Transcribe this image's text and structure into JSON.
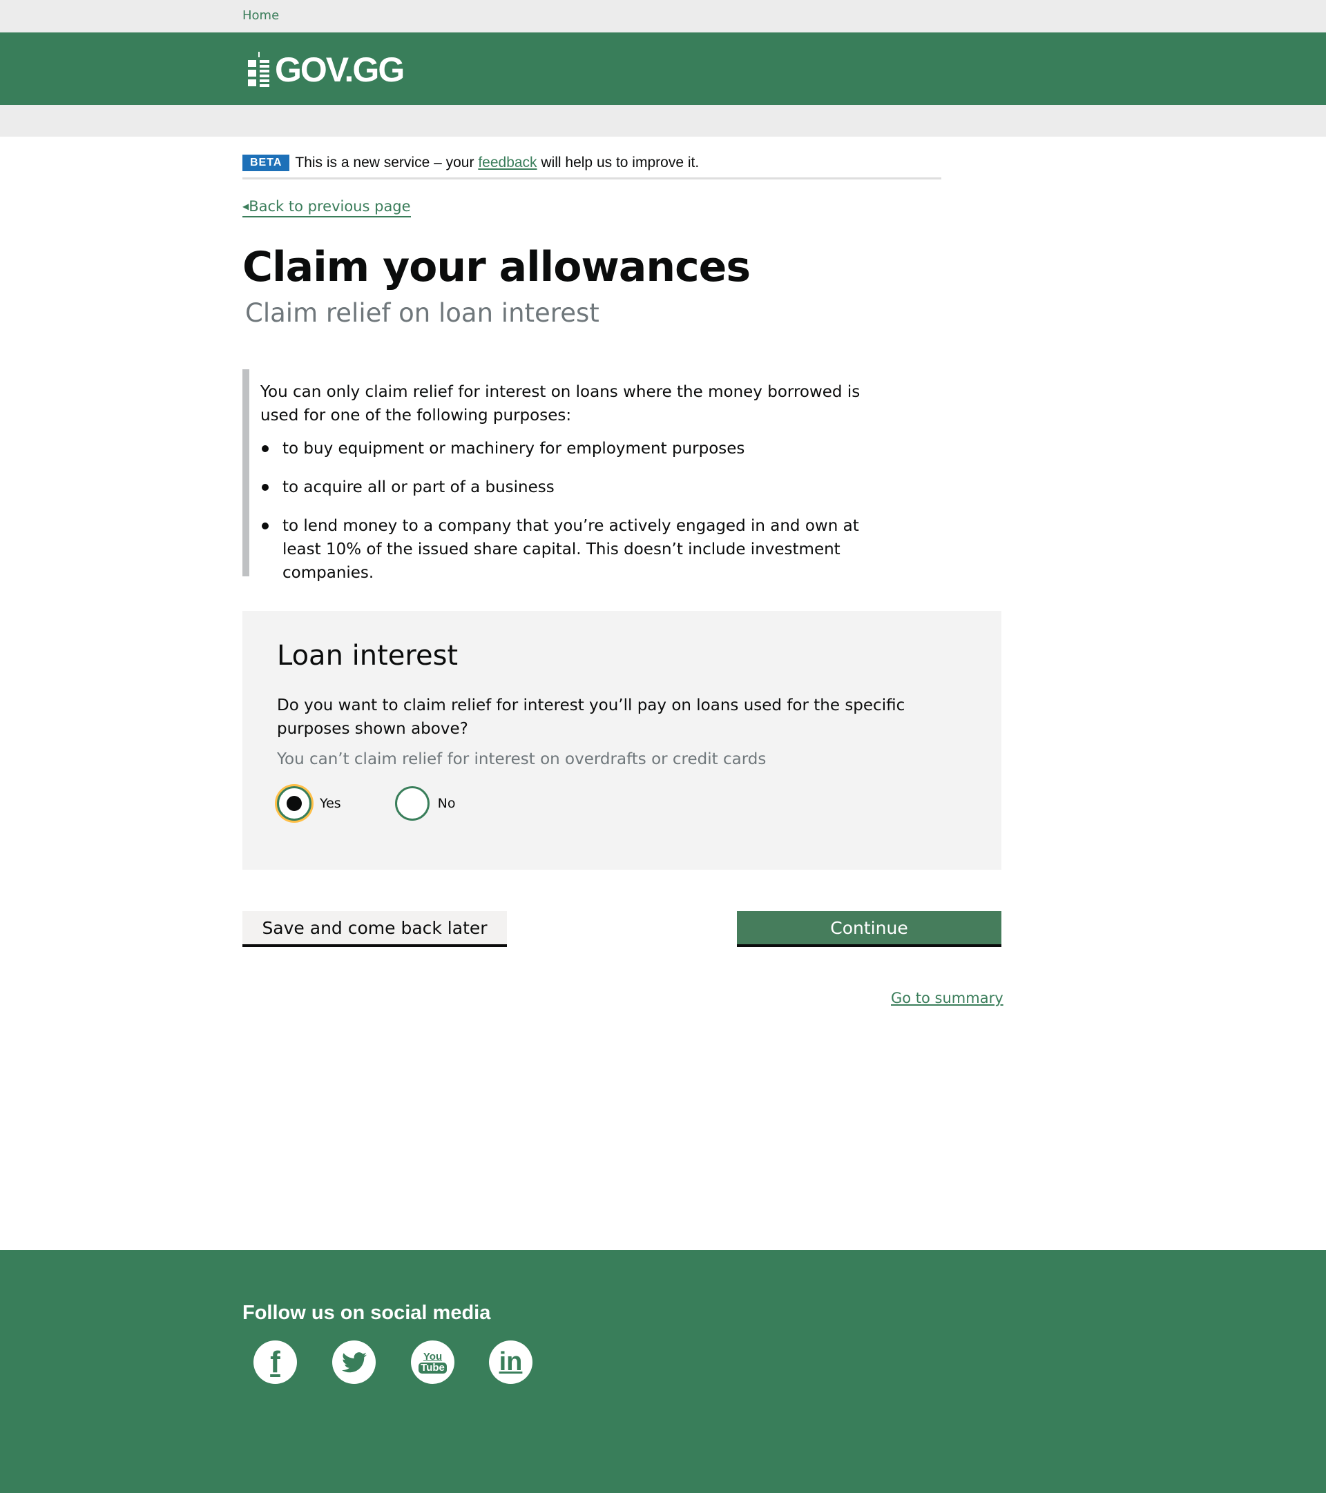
{
  "breadcrumb": {
    "home": "Home"
  },
  "header": {
    "logo_text": "GOV.GG"
  },
  "beta": {
    "tag": "BETA",
    "text_before": "This is a new service – your",
    "link": "feedback",
    "text_after": "will help us to improve it."
  },
  "back_link": "Back to previous page",
  "page": {
    "title": "Claim your allowances",
    "subtitle": "Claim relief on loan interest"
  },
  "inset": {
    "intro": "You can only claim relief for interest on loans where the money borrowed is used for one of the following purposes:",
    "items": [
      "to buy equipment or machinery for employment purposes",
      "to acquire all or part of a business",
      "to lend money to a company that you’re actively engaged in and own at least 10% of the issued share capital. This doesn’t include investment companies."
    ]
  },
  "form": {
    "heading": "Loan interest",
    "question": "Do you want to claim relief for interest you’ll pay on loans used for the specific purposes shown above?",
    "hint": "You can’t claim relief for interest on overdrafts or credit cards",
    "options": [
      {
        "label": "Yes",
        "selected": true
      },
      {
        "label": "No",
        "selected": false
      }
    ]
  },
  "actions": {
    "save": "Save and come back later",
    "continue": "Continue",
    "summary": "Go to summary"
  },
  "footer": {
    "heading": "Follow us on social media",
    "social": [
      {
        "icon": "facebook-icon",
        "glyph": "f"
      },
      {
        "icon": "twitter-icon",
        "glyph": "🐦"
      },
      {
        "icon": "youtube-icon",
        "glyph": "You Tube"
      },
      {
        "icon": "linkedin-icon",
        "glyph": "in"
      }
    ]
  },
  "colors": {
    "brand_green": "#397e5a",
    "beta_blue": "#1d70b8",
    "focus_yellow": "#ffbf47"
  }
}
